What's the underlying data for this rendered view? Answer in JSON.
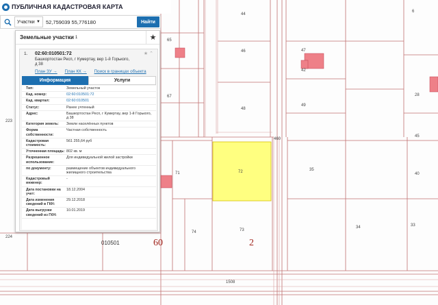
{
  "app": {
    "title": "ПУБЛИЧНАЯ КАДАСТРОВАЯ КАРТА"
  },
  "search": {
    "type_selected": "Участки",
    "query": "52,759039 55,776180",
    "button_label": "Найти"
  },
  "panel": {
    "title": "Земельные участки",
    "count": "1",
    "result": {
      "index": "1.",
      "cadastral_number": "02:60:010501:72",
      "address": "Башкортостан Респ, г Кумертау, вер 1-й Горького, д 38",
      "links": [
        "План ЗУ →",
        "План КК →",
        "Поиск в границах объекта →"
      ]
    },
    "tabs": [
      {
        "label": "Информация",
        "active": true
      },
      {
        "label": "Услуги",
        "active": false
      }
    ],
    "rows": [
      {
        "key": "Тип:",
        "value": "Земельный участок"
      },
      {
        "key": "Кад. номер:",
        "value": "02:60:010501:72",
        "link": true
      },
      {
        "key": "Кад. квартал:",
        "value": "02:60:010501",
        "link": true
      },
      {
        "key": "Статус:",
        "value": "Ранее учтенный"
      },
      {
        "key": "Адрес:",
        "value": "Башкортостан Респ, г Кумертау, вер 1-й Горького, д 38"
      },
      {
        "key": "Категория земель:",
        "value": "Земли населённых пунктов"
      },
      {
        "key": "Форма собственности:",
        "value": "Частная собственность"
      },
      {
        "key": "Кадастровая стоимость:",
        "value": "561 255,64 руб"
      },
      {
        "key": "Уточненная площадь:",
        "value": "802 кв. м"
      },
      {
        "key": "Разрешенное использование:",
        "value": "Для индивидуальной жилой застройки"
      },
      {
        "key": "по документу:",
        "value": "размещение объектов индивидуального жилищного строительства"
      },
      {
        "key": "Кадастровый инженер:",
        "value": "-"
      },
      {
        "key": "Дата постановки на учет:",
        "value": "18.12.2004"
      },
      {
        "key": "Дата изменения сведений в ГКН:",
        "value": "29.12.2018"
      },
      {
        "key": "Дата выгрузки сведений из ГКН:",
        "value": "10.01.2019"
      }
    ]
  },
  "map": {
    "parcel_labels": [
      "63",
      "44",
      "65",
      "46",
      "47",
      "42",
      "67",
      "48",
      "49",
      "28",
      "223",
      "460",
      "71",
      "72",
      "35",
      "73",
      "74",
      "33",
      "34",
      "224",
      "010501",
      "60",
      "2",
      "1508",
      "6",
      "47",
      "40",
      "45"
    ],
    "highlight_color": "#ffff80",
    "building_color": "#ee8088"
  },
  "icons": {
    "logo": "globe-icon",
    "search": "search-icon",
    "favorite": "star-icon"
  }
}
